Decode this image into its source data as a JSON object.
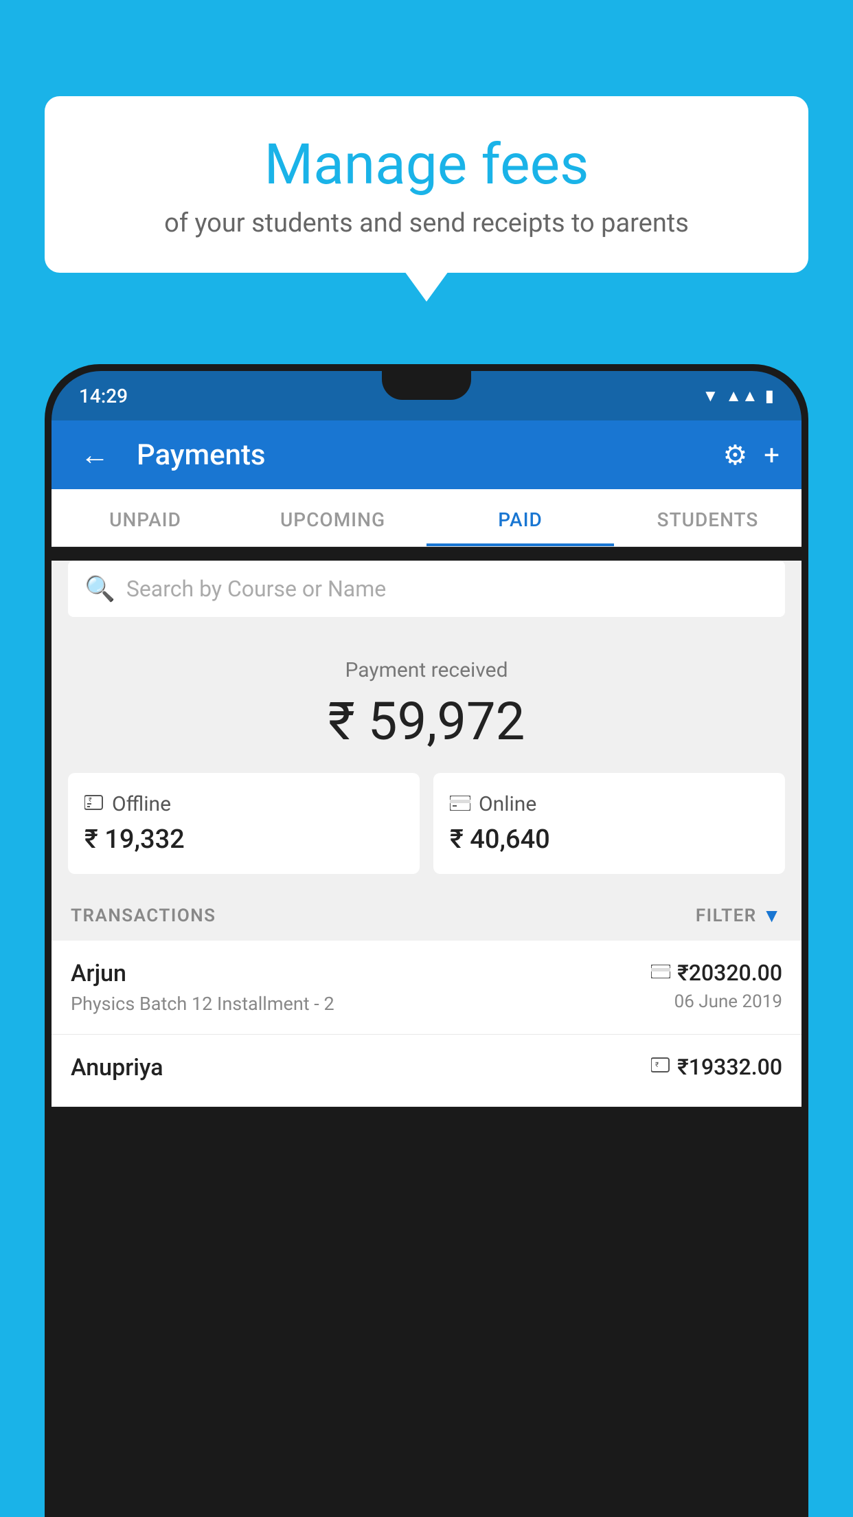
{
  "background_color": "#1ab3e8",
  "bubble": {
    "title": "Manage fees",
    "subtitle": "of your students and send receipts to parents"
  },
  "status_bar": {
    "time": "14:29",
    "wifi_icon": "▼",
    "signal_icon": "▲",
    "battery_icon": "▮"
  },
  "app_bar": {
    "title": "Payments",
    "back_icon": "←",
    "settings_icon": "⚙",
    "add_icon": "+"
  },
  "tabs": [
    {
      "label": "UNPAID",
      "active": false
    },
    {
      "label": "UPCOMING",
      "active": false
    },
    {
      "label": "PAID",
      "active": true
    },
    {
      "label": "STUDENTS",
      "active": false
    }
  ],
  "search": {
    "placeholder": "Search by Course or Name"
  },
  "payment": {
    "received_label": "Payment received",
    "total_amount": "₹ 59,972",
    "offline_label": "Offline",
    "offline_amount": "₹ 19,332",
    "online_label": "Online",
    "online_amount": "₹ 40,640"
  },
  "transactions": {
    "section_label": "TRANSACTIONS",
    "filter_label": "FILTER",
    "rows": [
      {
        "name": "Arjun",
        "course": "Physics Batch 12 Installment - 2",
        "amount": "₹20320.00",
        "date": "06 June 2019",
        "payment_type": "card"
      },
      {
        "name": "Anupriya",
        "course": "",
        "amount": "₹19332.00",
        "date": "",
        "payment_type": "offline"
      }
    ]
  }
}
